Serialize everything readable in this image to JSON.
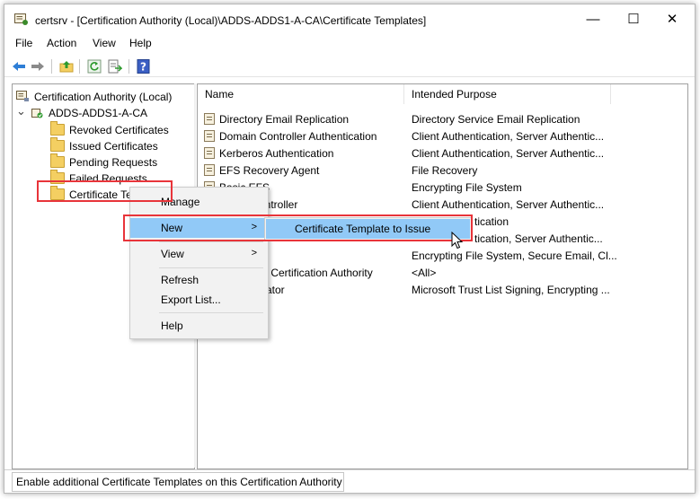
{
  "window": {
    "title": "certsrv - [Certification Authority (Local)\\ADDS-ADDS1-A-CA\\Certificate Templates]",
    "minimize": "—",
    "maximize": "☐",
    "close": "✕"
  },
  "menubar": [
    "File",
    "Action",
    "View",
    "Help"
  ],
  "toolbar": [
    "back-icon",
    "forward-icon",
    "up-folder-icon",
    "refresh-icon",
    "export-list-icon",
    "help-icon"
  ],
  "tree": {
    "root": "Certification Authority (Local)",
    "ca": "ADDS-ADDS1-A-CA",
    "expander": "⌄",
    "items": [
      "Revoked Certificates",
      "Issued Certificates",
      "Pending Requests",
      "Failed Requests",
      "Certificate Templates"
    ],
    "selected_visible_label": "Certificate Te"
  },
  "list": {
    "columns": [
      "Name",
      "Intended Purpose"
    ],
    "rows": [
      {
        "name": "Directory Email Replication",
        "purpose": "Directory Service Email Replication"
      },
      {
        "name": "Domain Controller Authentication",
        "purpose": "Client Authentication, Server Authentic..."
      },
      {
        "name": "Kerberos Authentication",
        "purpose": "Client Authentication, Server Authentic..."
      },
      {
        "name": "EFS Recovery Agent",
        "purpose": "File Recovery"
      },
      {
        "name": "Basic EFS",
        "purpose": "Encrypting File System"
      },
      {
        "name": "ontroller",
        "purpose": "Client Authentication, Server Authentic..."
      },
      {
        "name": "",
        "purpose": "tication"
      },
      {
        "name": "",
        "purpose": "tication, Server Authentic..."
      },
      {
        "name": "",
        "purpose": "Encrypting File System, Secure Email, Cl..."
      },
      {
        "name": "te Certification Authority",
        "purpose": "<All>"
      },
      {
        "name": "ator",
        "purpose": "Microsoft Trust List Signing, Encrypting ..."
      }
    ]
  },
  "context_menu": {
    "items": [
      {
        "label": "Manage",
        "arrow": ""
      },
      {
        "label": "New",
        "arrow": ">"
      },
      {
        "label": "View",
        "arrow": ">"
      },
      {
        "label": "Refresh",
        "arrow": ""
      },
      {
        "label": "Export List...",
        "arrow": ""
      },
      {
        "label": "Help",
        "arrow": ""
      }
    ],
    "submenu_item": "Certificate Template to Issue"
  },
  "statusbar": {
    "text": "Enable additional Certificate Templates on this Certification Authority"
  },
  "colors": {
    "highlight": "#91c9f7",
    "annotation_red": "#e8343a",
    "folder": "#f4cf62"
  }
}
